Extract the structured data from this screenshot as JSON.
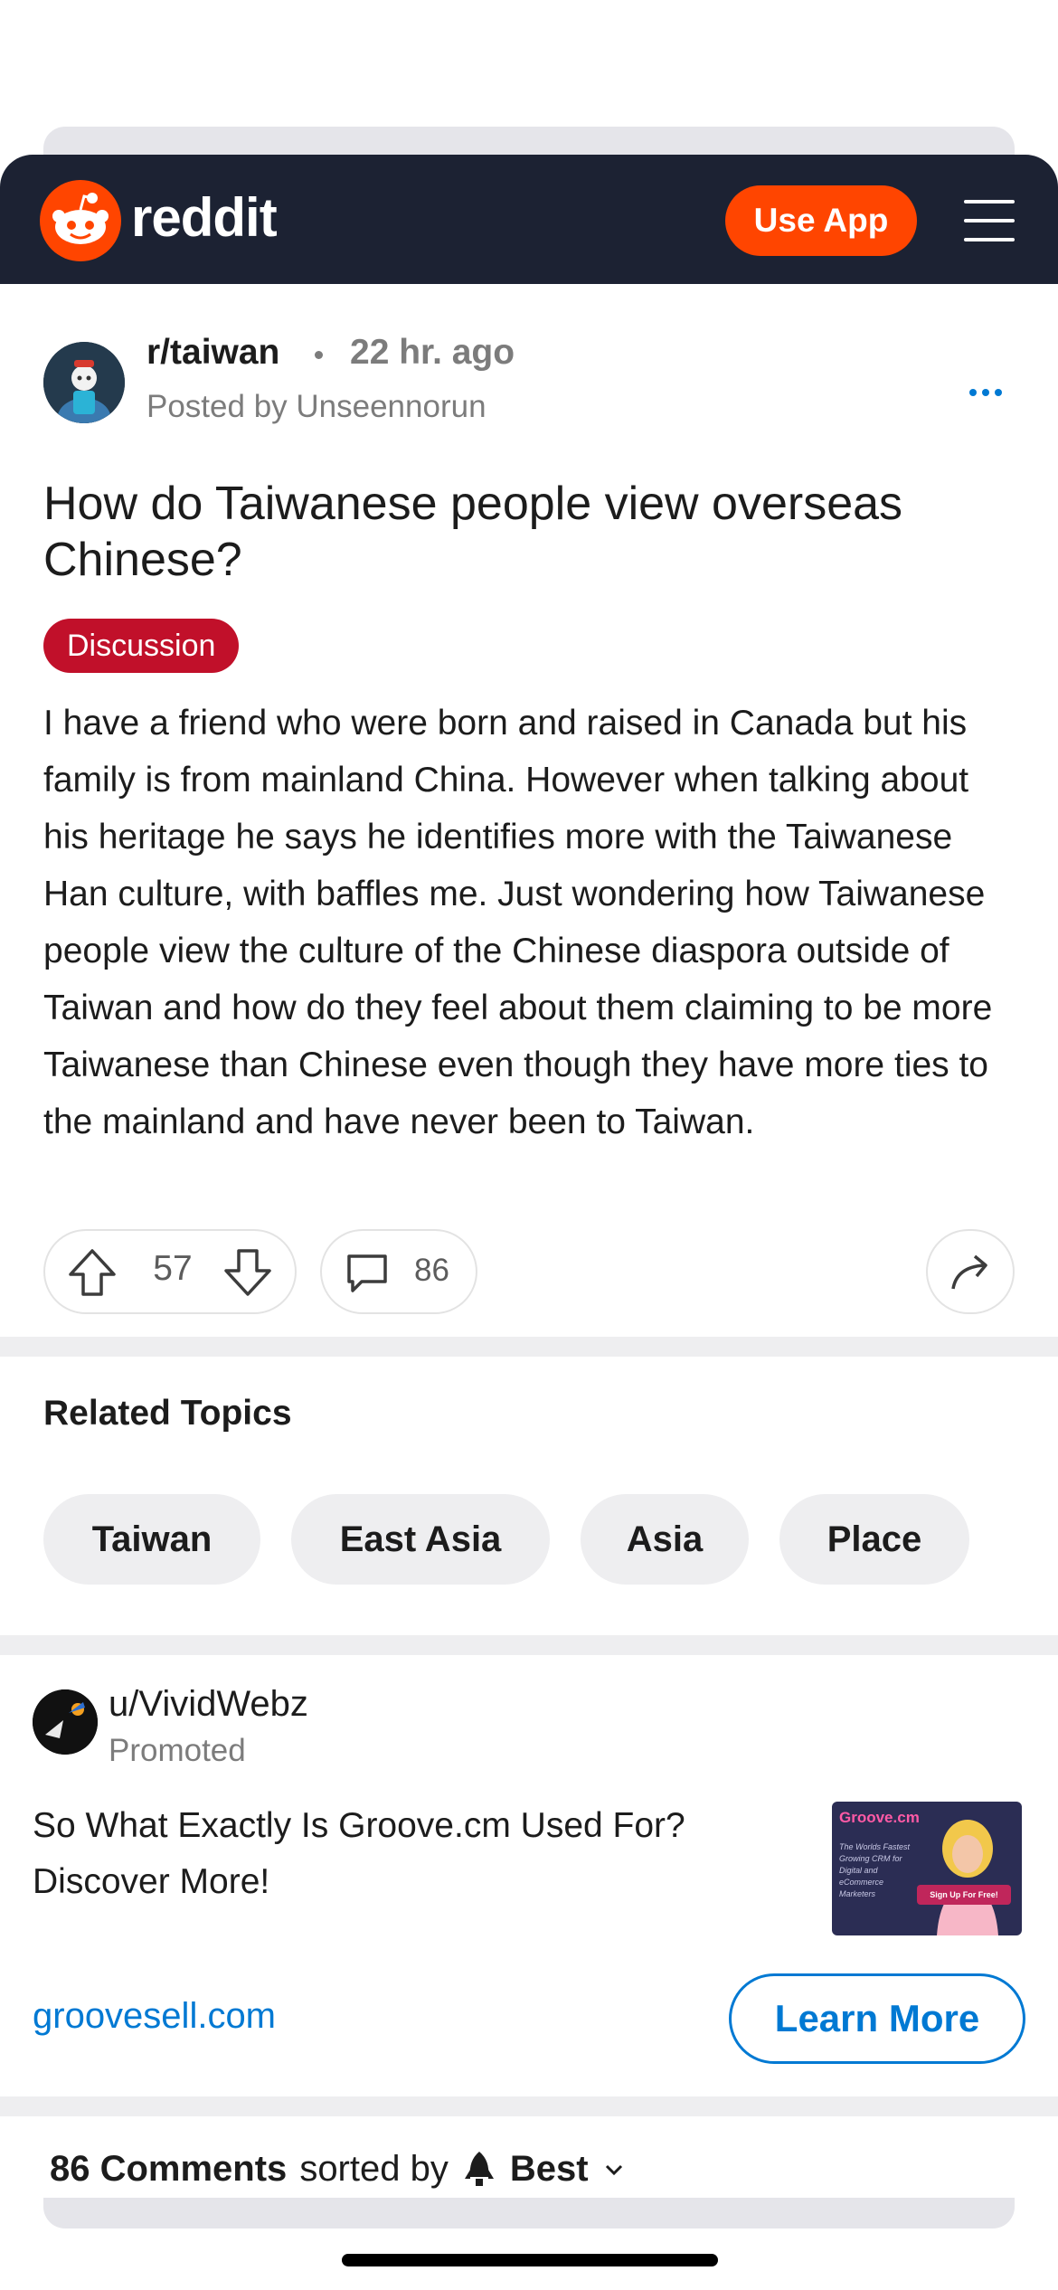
{
  "header": {
    "logo_text": "reddit",
    "use_app_label": "Use App"
  },
  "post": {
    "subreddit": "r/taiwan",
    "time_ago": "22 hr. ago",
    "posted_by": "Posted by Unseennorun",
    "title": "How do Taiwanese people view overseas Chinese?",
    "flair": "Discussion",
    "body": "I have a friend who were born and raised in Canada but his family is from mainland China. However when talking about his heritage he says he identifies more with the Taiwanese Han culture, with baffles me. Just wondering how Taiwanese people view the culture of the Chinese diaspora outside of Taiwan and how do they feel about them claiming to be more Taiwanese than Chinese even though they have more ties to the mainland and have never been to Taiwan.",
    "votes": "57",
    "comments": "86"
  },
  "related": {
    "heading": "Related Topics",
    "topics": [
      "Taiwan",
      "East Asia",
      "Asia",
      "Place"
    ]
  },
  "ad": {
    "user": "u/VividWebz",
    "promoted": "Promoted",
    "text": "So What Exactly Is Groove.cm Used For? Discover More!",
    "link": "groovesell.com",
    "cta": "Learn More",
    "thumb_brand": "Groove.cm",
    "thumb_tagline": "The Worlds Fastest Growing CRM for Digital and eCommerce Marketers",
    "thumb_button": "Sign Up For Free!"
  },
  "comments_bar": {
    "count": "86 Comments",
    "sorted_by": "sorted by",
    "sort": "Best"
  },
  "colors": {
    "brand": "#ff4500",
    "header_bg": "#1c2233",
    "link": "#0079d3",
    "flair": "#c1102a"
  }
}
